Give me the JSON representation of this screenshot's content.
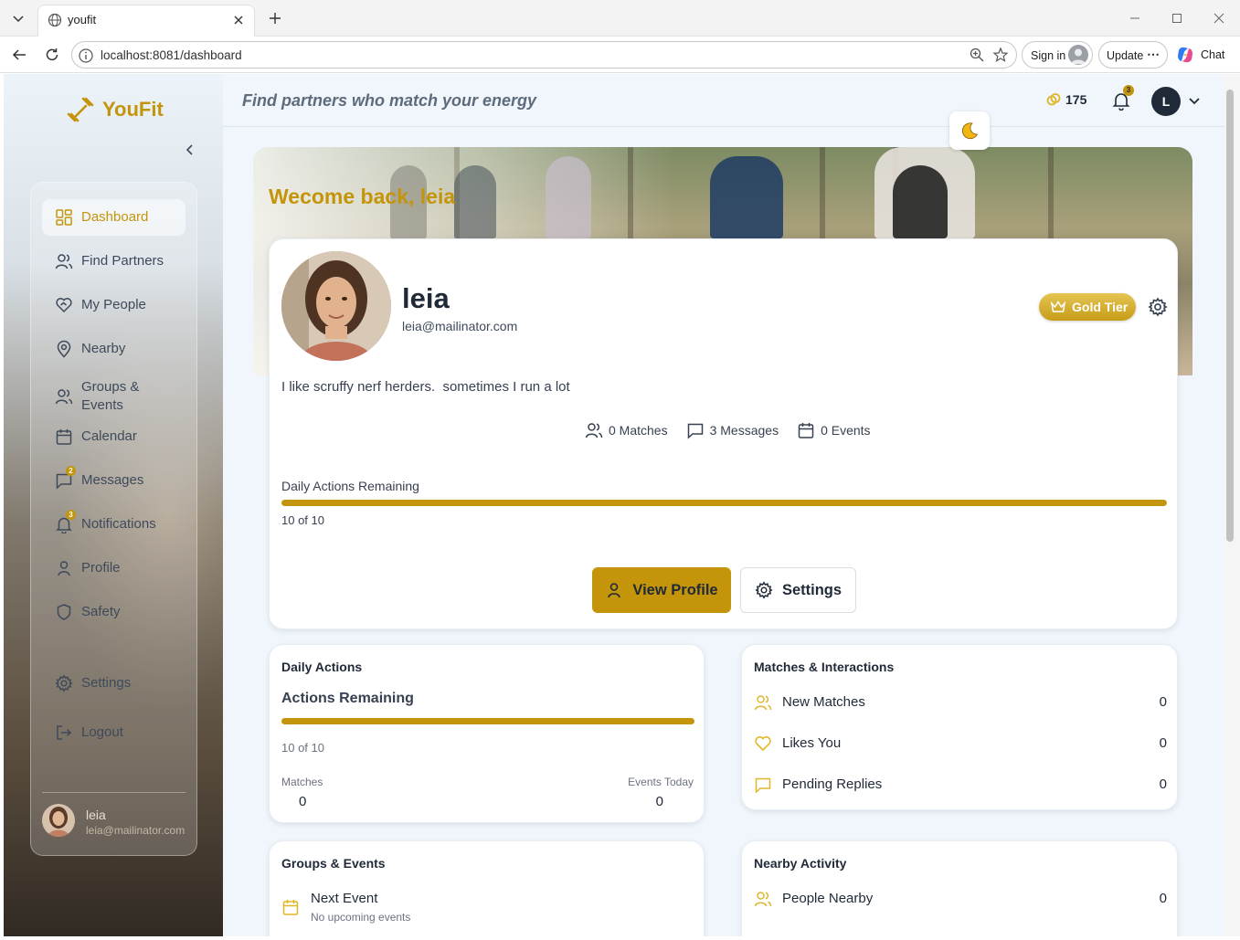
{
  "browser": {
    "tab_title": "youfit",
    "url": "localhost:8081/dashboard",
    "sign_in": "Sign in",
    "update": "Update",
    "chat": "Chat"
  },
  "brand": {
    "name": "YouFit"
  },
  "sidebar": {
    "items": [
      {
        "label": "Dashboard",
        "icon": "dashboard-icon",
        "active": true
      },
      {
        "label": "Find Partners",
        "icon": "users-icon"
      },
      {
        "label": "My People",
        "icon": "heart-handshake-icon"
      },
      {
        "label": "Nearby",
        "icon": "map-pin-icon"
      },
      {
        "label": "Groups & Events",
        "icon": "group-icon"
      },
      {
        "label": "Calendar",
        "icon": "calendar-icon"
      },
      {
        "label": "Messages",
        "icon": "message-icon",
        "badge": "2"
      },
      {
        "label": "Notifications",
        "icon": "bell-icon",
        "badge": "3"
      },
      {
        "label": "Profile",
        "icon": "user-icon"
      },
      {
        "label": "Safety",
        "icon": "shield-icon"
      },
      {
        "label": "Settings",
        "icon": "gear-icon"
      },
      {
        "label": "Logout",
        "icon": "logout-icon"
      }
    ],
    "user": {
      "name": "leia",
      "email": "leia@mailinator.com"
    }
  },
  "header": {
    "tagline": "Find partners who match your energy",
    "coins": "175",
    "notification_count": "3",
    "avatar_initial": "L"
  },
  "welcome": "Wecome back, leia",
  "profile": {
    "name": "leia",
    "email": "leia@mailinator.com",
    "tier": "Gold Tier",
    "bio": "I like scruffy nerf herders.  sometimes I run a lot",
    "stats": {
      "matches": "0 Matches",
      "messages": "3 Messages",
      "events": "0 Events"
    },
    "daily_label": "Daily Actions Remaining",
    "daily_value": "10 of 10",
    "daily_fraction": 1.0,
    "view_profile": "View Profile",
    "settings": "Settings"
  },
  "daily_actions": {
    "title": "Daily Actions",
    "subtitle": "Actions Remaining",
    "value": "10 of 10",
    "fraction": 1.0,
    "matches_label": "Matches",
    "matches_value": "0",
    "events_label": "Events Today",
    "events_value": "0"
  },
  "matches_interactions": {
    "title": "Matches & Interactions",
    "rows": [
      {
        "label": "New Matches",
        "value": "0",
        "icon": "users-icon"
      },
      {
        "label": "Likes You",
        "value": "0",
        "icon": "heart-icon"
      },
      {
        "label": "Pending Replies",
        "value": "0",
        "icon": "message-icon"
      }
    ]
  },
  "groups_events": {
    "title": "Groups & Events",
    "next_label": "Next Event",
    "next_sub": "No upcoming events"
  },
  "nearby_activity": {
    "title": "Nearby Activity",
    "rows": [
      {
        "label": "People Nearby",
        "value": "0"
      }
    ]
  },
  "colors": {
    "accent": "#c4950a",
    "background": "#f0f6fc"
  }
}
